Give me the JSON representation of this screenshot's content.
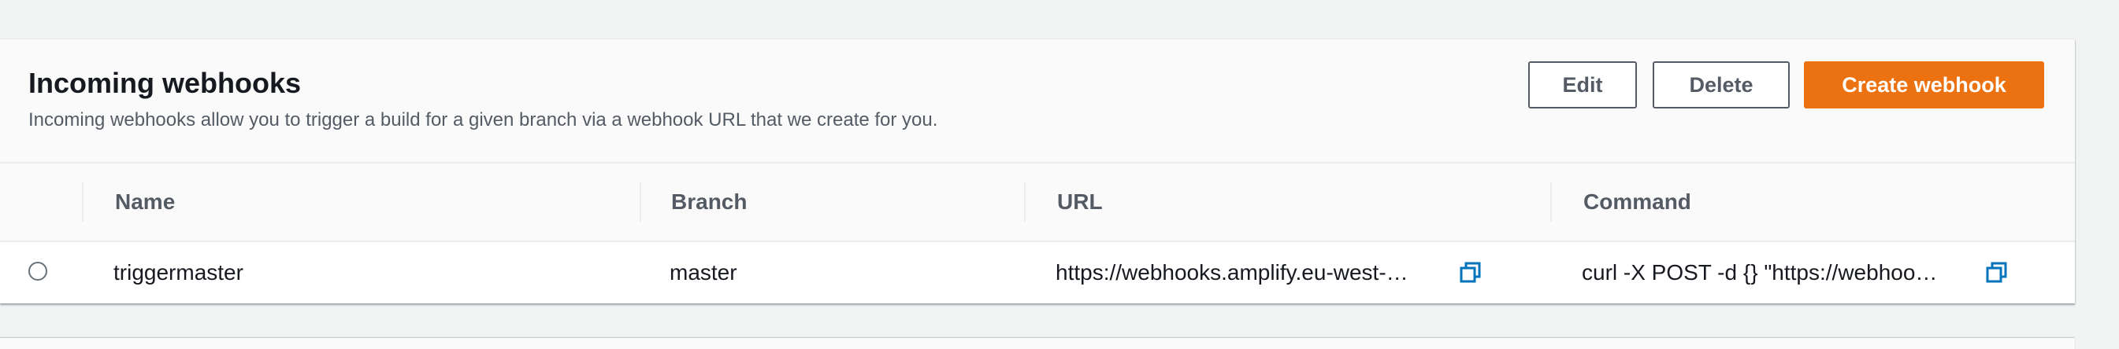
{
  "panel": {
    "title": "Incoming webhooks",
    "description": "Incoming webhooks allow you to trigger a build for a given branch via a webhook URL that we create for you.",
    "buttons": {
      "edit": "Edit",
      "delete": "Delete",
      "create": "Create webhook"
    }
  },
  "table": {
    "columns": [
      "Name",
      "Branch",
      "URL",
      "Command"
    ],
    "rows": [
      {
        "name": "triggermaster",
        "branch": "master",
        "url": "https://webhooks.amplify.eu-west-…",
        "command": "curl -X POST -d {} \"https://webhoo…"
      }
    ]
  },
  "icons": {
    "copy": "copy-icon",
    "radio": "radio-unselected"
  },
  "colors": {
    "primary": "#ec7211",
    "link_icon": "#0073bb",
    "text": "#16191f",
    "muted": "#545b64"
  }
}
